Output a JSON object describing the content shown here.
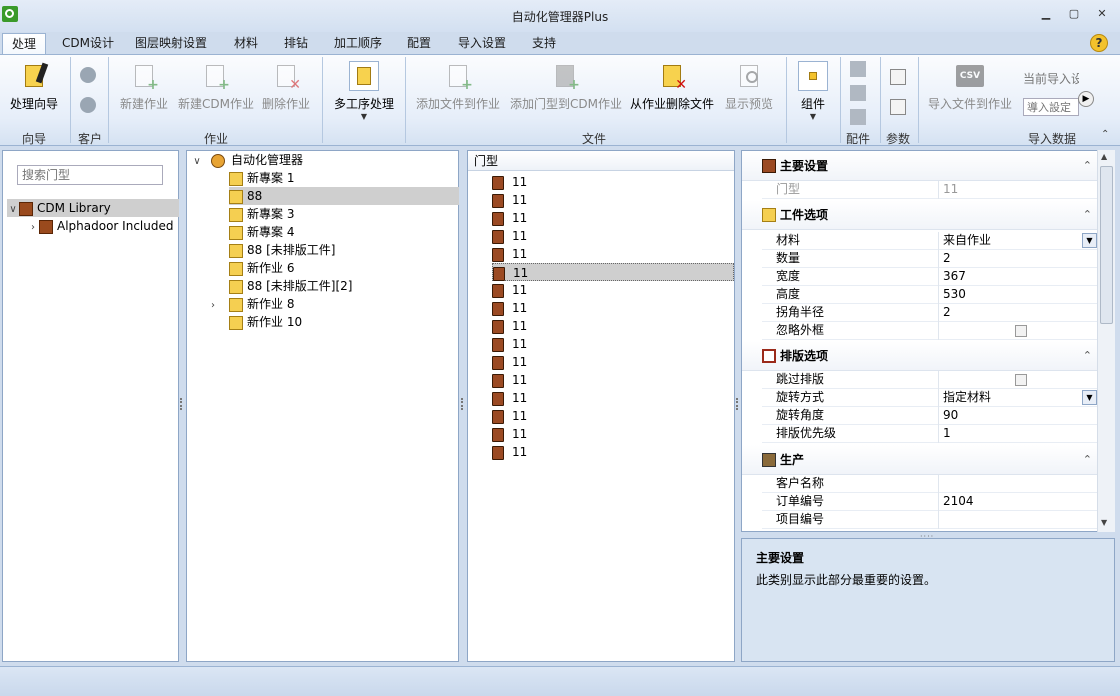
{
  "window": {
    "title": "自动化管理器Plus"
  },
  "tabs": [
    "处理",
    "CDM设计",
    "图层映射设置",
    "材料",
    "排钻",
    "加工顺序",
    "配置",
    "导入设置",
    "支持"
  ],
  "ribbon": {
    "wizard": {
      "btn": "处理向导",
      "group": "向导"
    },
    "customer": {
      "group": "客户"
    },
    "job": {
      "new_job": "新建作业",
      "new_cdm_job": "新建CDM作业",
      "delete_job": "删除作业",
      "group": "作业"
    },
    "multi": {
      "btn": "多工序处理"
    },
    "file": {
      "add_file": "添加文件到作业",
      "add_door": "添加门型到CDM作业",
      "remove": "从作业删除文件",
      "preview": "显示预览",
      "group": "文件"
    },
    "component": {
      "btn": "组件"
    },
    "parts": {
      "group": "配件"
    },
    "params": {
      "group": "参数"
    },
    "import": {
      "import_file": "导入文件到作业",
      "current_label": "当前导入设",
      "input_placeholder": "導入設定",
      "group": "导入数据",
      "csv": "CSV"
    }
  },
  "left_tree": {
    "search_placeholder": "搜索门型",
    "items": [
      "CDM Library",
      "Alphadoor Included"
    ]
  },
  "jobs_tree": {
    "root": "自动化管理器",
    "items": [
      "新專案 1",
      "88",
      "新專案 3",
      "新專案 4",
      "88 [未排版工件]",
      "新作业 6",
      "88 [未排版工件][2]",
      "新作业 8",
      "新作业 10"
    ]
  },
  "door_list": {
    "header": "门型",
    "items": [
      "11",
      "11",
      "11",
      "11",
      "11",
      "11",
      "11",
      "11",
      "11",
      "11",
      "11",
      "11",
      "11",
      "11",
      "11",
      "11"
    ]
  },
  "properties": {
    "main": {
      "title": "主要设置",
      "rows": [
        {
          "label": "门型",
          "value": "11"
        }
      ]
    },
    "workpiece": {
      "title": "工件选项",
      "rows": [
        {
          "label": "材料",
          "value": "来自作业"
        },
        {
          "label": "数量",
          "value": "2"
        },
        {
          "label": "宽度",
          "value": "367"
        },
        {
          "label": "高度",
          "value": "530"
        },
        {
          "label": "拐角半径",
          "value": "2"
        },
        {
          "label": "忽略外框",
          "value": ""
        }
      ]
    },
    "nesting": {
      "title": "排版选项",
      "rows": [
        {
          "label": "跳过排版",
          "value": ""
        },
        {
          "label": "旋转方式",
          "value": "指定材料"
        },
        {
          "label": "旋转角度",
          "value": "90"
        },
        {
          "label": "排版优先级",
          "value": "1"
        }
      ]
    },
    "production": {
      "title": "生产",
      "rows": [
        {
          "label": "客户名称",
          "value": ""
        },
        {
          "label": "订单编号",
          "value": "2104"
        },
        {
          "label": "项目编号",
          "value": ""
        }
      ]
    }
  },
  "description": {
    "title": "主要设置",
    "text": "此类别显示此部分最重要的设置。"
  },
  "colors": {
    "accent": "#cfdced",
    "selection": "#cfcfcf",
    "ribbon": "#e6eef9"
  }
}
